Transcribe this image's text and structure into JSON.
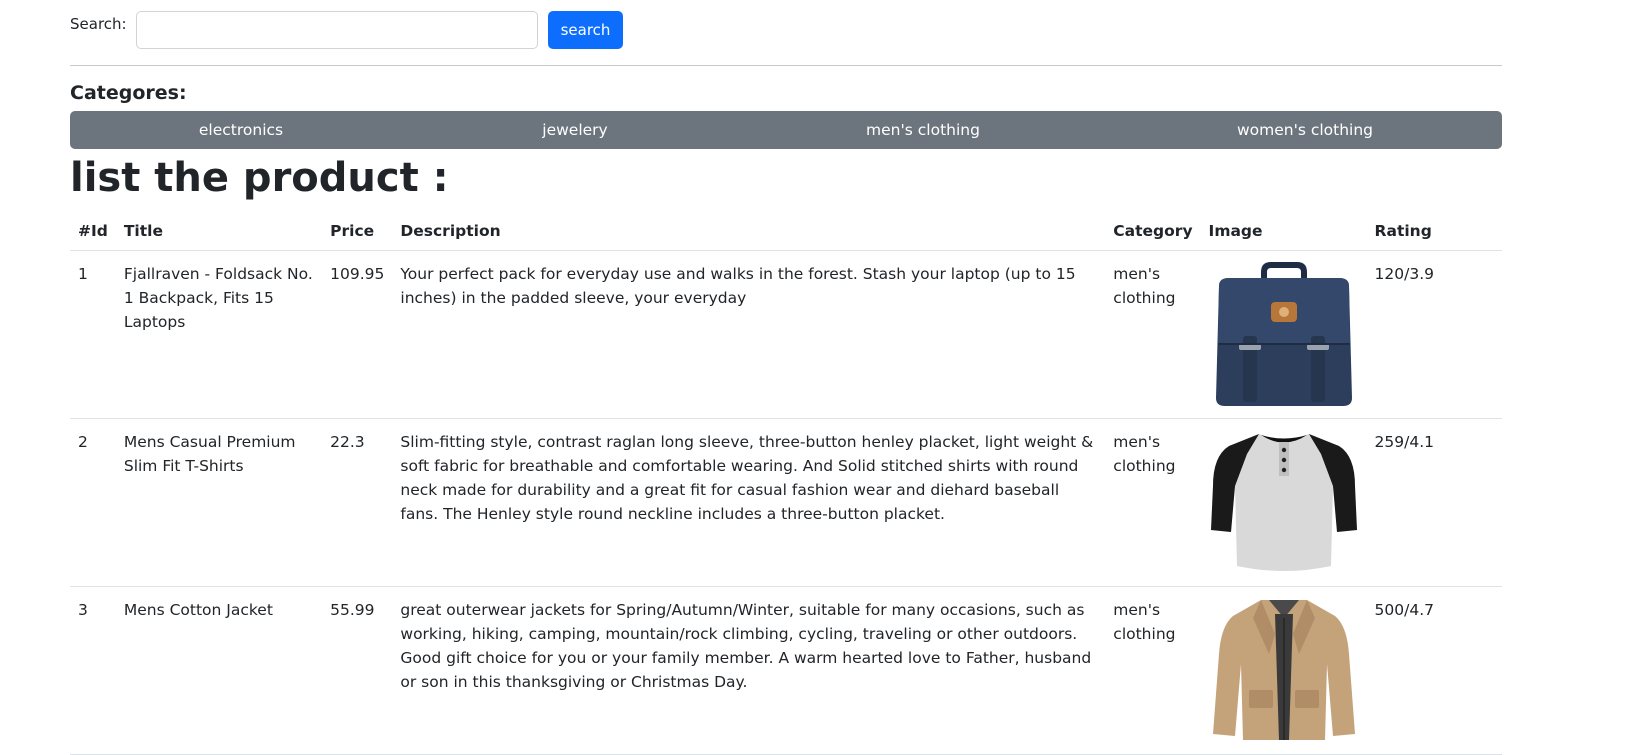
{
  "search": {
    "label": "Search:",
    "placeholder": "",
    "value": "",
    "button_label": "search"
  },
  "categories": {
    "title": "Categores:",
    "items": [
      "electronics",
      "jewelery",
      "men's clothing",
      "women's clothing"
    ]
  },
  "page_title": "list the product :",
  "table": {
    "headers": [
      "#Id",
      "Title",
      "Price",
      "Description",
      "Category",
      "Image",
      "Rating"
    ],
    "rows": [
      {
        "id": "1",
        "title": "Fjallraven - Foldsack No. 1 Backpack, Fits 15 Laptops",
        "price": "109.95",
        "description": "Your perfect pack for everyday use and walks in the forest. Stash your laptop (up to 15 inches) in the padded sleeve, your everyday",
        "category": "men's clothing",
        "image": "navy-backpack",
        "rating": "120/3.9"
      },
      {
        "id": "2",
        "title": "Mens Casual Premium Slim Fit T-Shirts",
        "price": "22.3",
        "description": "Slim-fitting style, contrast raglan long sleeve, three-button henley placket, light weight & soft fabric for breathable and comfortable wearing. And Solid stitched shirts with round neck made for durability and a great fit for casual fashion wear and diehard baseball fans. The Henley style round neckline includes a three-button placket.",
        "category": "men's clothing",
        "image": "raglan-henley-shirt",
        "rating": "259/4.1"
      },
      {
        "id": "3",
        "title": "Mens Cotton Jacket",
        "price": "55.99",
        "description": "great outerwear jackets for Spring/Autumn/Winter, suitable for many occasions, such as working, hiking, camping, mountain/rock climbing, cycling, traveling or other outdoors. Good gift choice for you or your family member. A warm hearted love to Father, husband or son in this thanksgiving or Christmas Day.",
        "category": "men's clothing",
        "image": "khaki-cotton-jacket",
        "rating": "500/4.7"
      }
    ]
  },
  "colors": {
    "primary": "#0d6efd",
    "category_bar": "#6c757d",
    "text": "#212529"
  }
}
